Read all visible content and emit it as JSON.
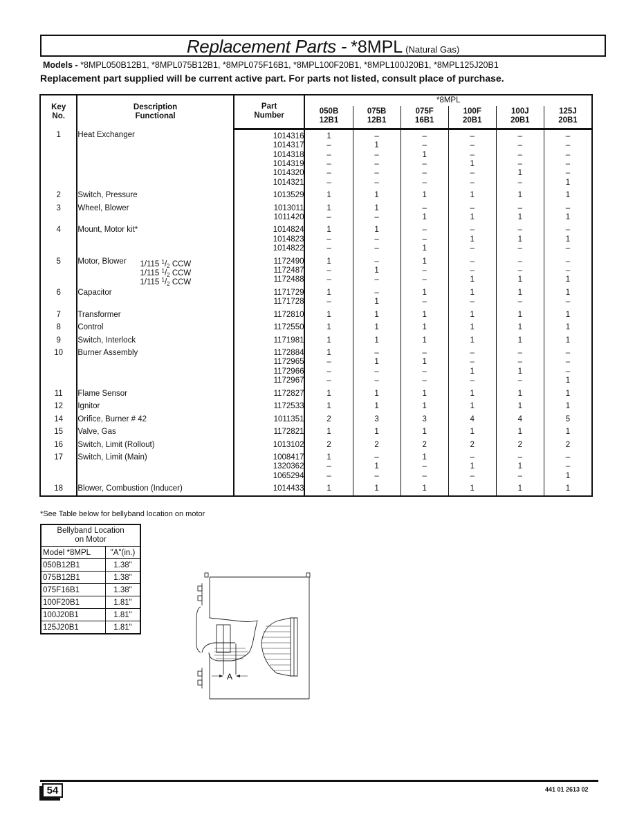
{
  "header": {
    "title": "Replacement Parts -",
    "code": "*8MPL",
    "subtitle": "(Natural Gas)"
  },
  "models_label": "Models -",
  "models_list": "*8MPL050B12B1, *8MPL075B12B1,  *8MPL075F16B1, *8MPL100F20B1, *8MPL100J20B1, *8MPL125J20B1",
  "supply_note": "Replacement part supplied will be current active part.  For parts not listed, consult place of purchase.",
  "parts_table": {
    "headers": {
      "key": [
        "Key",
        "No."
      ],
      "desc": [
        "Description",
        "Functional"
      ],
      "part": [
        "Part",
        "Number"
      ],
      "group": "*8MPL",
      "models": [
        [
          "050B",
          "12B1"
        ],
        [
          "075B",
          "12B1"
        ],
        [
          "075F",
          "16B1"
        ],
        [
          "100F",
          "20B1"
        ],
        [
          "100J",
          "20B1"
        ],
        [
          "125J",
          "20B1"
        ]
      ]
    },
    "rows": [
      {
        "key": "1",
        "desc": "Heat Exchanger",
        "parts": [
          {
            "part": "1014316",
            "qty": [
              "1",
              "–",
              "–",
              "–",
              "–",
              "–"
            ]
          },
          {
            "part": "1014317",
            "qty": [
              "–",
              "1",
              "–",
              "–",
              "–",
              "–"
            ]
          },
          {
            "part": "1014318",
            "qty": [
              "–",
              "–",
              "1",
              "–",
              "–",
              "–"
            ]
          },
          {
            "part": "1014319",
            "qty": [
              "–",
              "–",
              "–",
              "1",
              "–",
              "–"
            ]
          },
          {
            "part": "1014320",
            "qty": [
              "–",
              "–",
              "–",
              "–",
              "1",
              "–"
            ]
          },
          {
            "part": "1014321",
            "qty": [
              "–",
              "–",
              "–",
              "–",
              "–",
              "1"
            ]
          }
        ]
      },
      {
        "key": "2",
        "desc": "Switch, Pressure",
        "parts": [
          {
            "part": "1013529",
            "qty": [
              "1",
              "1",
              "1",
              "1",
              "1",
              "1"
            ]
          }
        ]
      },
      {
        "key": "3",
        "desc": "Wheel, Blower",
        "parts": [
          {
            "part": "1013011",
            "qty": [
              "1",
              "1",
              "–",
              "–",
              "–",
              "–"
            ]
          },
          {
            "part": "1011420",
            "qty": [
              "–",
              "–",
              "1",
              "1",
              "1",
              "1"
            ]
          }
        ]
      },
      {
        "key": "4",
        "desc": "Mount, Motor kit*",
        "parts": [
          {
            "part": "1014824",
            "qty": [
              "1",
              "1",
              "–",
              "–",
              "–",
              "–"
            ]
          },
          {
            "part": "1014823",
            "qty": [
              "–",
              "–",
              "–",
              "1",
              "1",
              "1"
            ]
          },
          {
            "part": "1014822",
            "qty": [
              "–",
              "–",
              "1",
              "–",
              "–",
              "–"
            ]
          }
        ]
      },
      {
        "key": "5",
        "desc": "Motor, Blower",
        "specs": [
          {
            "hp": "1/115",
            "num": "1",
            "den": "2",
            "rot": "CCW"
          },
          {
            "hp": "1/115",
            "num": "1",
            "den": "2",
            "rot": "CCW"
          },
          {
            "hp": "1/115",
            "num": "1",
            "den": "2",
            "rot": "CCW"
          }
        ],
        "parts": [
          {
            "part": "1172490",
            "qty": [
              "1",
              "–",
              "1",
              "–",
              "–",
              "–"
            ]
          },
          {
            "part": "1172487",
            "qty": [
              "–",
              "1",
              "–",
              "–",
              "–",
              "–"
            ]
          },
          {
            "part": "1172488",
            "qty": [
              "–",
              "–",
              "–",
              "1",
              "1",
              "1"
            ]
          }
        ]
      },
      {
        "key": "6",
        "desc": "Capacitor",
        "parts": [
          {
            "part": "1171729",
            "qty": [
              "1",
              "–",
              "1",
              "1",
              "1",
              "1"
            ]
          },
          {
            "part": "1171728",
            "qty": [
              "–",
              "1",
              "–",
              "–",
              "–",
              "–"
            ]
          }
        ]
      },
      {
        "key": "7",
        "desc": "Transformer",
        "parts": [
          {
            "part": "1172810",
            "qty": [
              "1",
              "1",
              "1",
              "1",
              "1",
              "1"
            ]
          }
        ]
      },
      {
        "key": "8",
        "desc": "Control",
        "parts": [
          {
            "part": "1172550",
            "qty": [
              "1",
              "1",
              "1",
              "1",
              "1",
              "1"
            ]
          }
        ]
      },
      {
        "key": "9",
        "desc": "Switch, Interlock",
        "parts": [
          {
            "part": "1171981",
            "qty": [
              "1",
              "1",
              "1",
              "1",
              "1",
              "1"
            ]
          }
        ]
      },
      {
        "key": "10",
        "desc": "Burner Assembly",
        "parts": [
          {
            "part": "1172884",
            "qty": [
              "1",
              "–",
              "–",
              "–",
              "–",
              "–"
            ]
          },
          {
            "part": "1172965",
            "qty": [
              "–",
              "1",
              "1",
              "–",
              "–",
              "–"
            ]
          },
          {
            "part": "1172966",
            "qty": [
              "–",
              "–",
              "–",
              "1",
              "1",
              "–"
            ]
          },
          {
            "part": "1172967",
            "qty": [
              "–",
              "–",
              "–",
              "–",
              "–",
              "1"
            ]
          }
        ]
      },
      {
        "key": "11",
        "desc": "Flame Sensor",
        "parts": [
          {
            "part": "1172827",
            "qty": [
              "1",
              "1",
              "1",
              "1",
              "1",
              "1"
            ]
          }
        ]
      },
      {
        "key": "12",
        "desc": "Ignitor",
        "parts": [
          {
            "part": "1172533",
            "qty": [
              "1",
              "1",
              "1",
              "1",
              "1",
              "1"
            ]
          }
        ]
      },
      {
        "key": "14",
        "desc": "Orifice, Burner # 42",
        "parts": [
          {
            "part": "1011351",
            "qty": [
              "2",
              "3",
              "3",
              "4",
              "4",
              "5"
            ]
          }
        ]
      },
      {
        "key": "15",
        "desc": "Valve, Gas",
        "parts": [
          {
            "part": "1172821",
            "qty": [
              "1",
              "1",
              "1",
              "1",
              "1",
              "1"
            ]
          }
        ]
      },
      {
        "key": "16",
        "desc": "Switch, Limit (Rollout)",
        "parts": [
          {
            "part": "1013102",
            "qty": [
              "2",
              "2",
              "2",
              "2",
              "2",
              "2"
            ]
          }
        ]
      },
      {
        "key": "17",
        "desc": "Switch, Limit (Main)",
        "parts": [
          {
            "part": "1008417",
            "qty": [
              "1",
              "–",
              "1",
              "–",
              "–",
              "–"
            ]
          },
          {
            "part": "1320362",
            "qty": [
              "–",
              "1",
              "–",
              "1",
              "1",
              "–"
            ]
          },
          {
            "part": "1065294",
            "qty": [
              "–",
              "–",
              "–",
              "–",
              "–",
              "1"
            ]
          }
        ]
      },
      {
        "key": "18",
        "desc": "Blower, Combustion (Inducer)",
        "parts": [
          {
            "part": "1014433",
            "qty": [
              "1",
              "1",
              "1",
              "1",
              "1",
              "1"
            ]
          }
        ]
      }
    ]
  },
  "footnote": "*See Table below for bellyband location on motor",
  "bellyband_table": {
    "title": [
      "Bellyband Location",
      "on Motor"
    ],
    "col_model": "Model *8MPL",
    "col_a": "\"A\"(in.)",
    "rows": [
      {
        "model": "050B12B1",
        "a": "1.38\""
      },
      {
        "model": "075B12B1",
        "a": "1.38\""
      },
      {
        "model": "075F16B1",
        "a": "1.38\""
      },
      {
        "model": "100F20B1",
        "a": "1.81\""
      },
      {
        "model": "100J20B1",
        "a": "1.81\""
      },
      {
        "model": "125J20B1",
        "a": "1.81\""
      }
    ]
  },
  "diagram": {
    "dimension_label": "A",
    "icon": "blower-motor-bellyband-diagram"
  },
  "footer": {
    "page_number": "54",
    "doc_number": "441 01 2613 02"
  }
}
